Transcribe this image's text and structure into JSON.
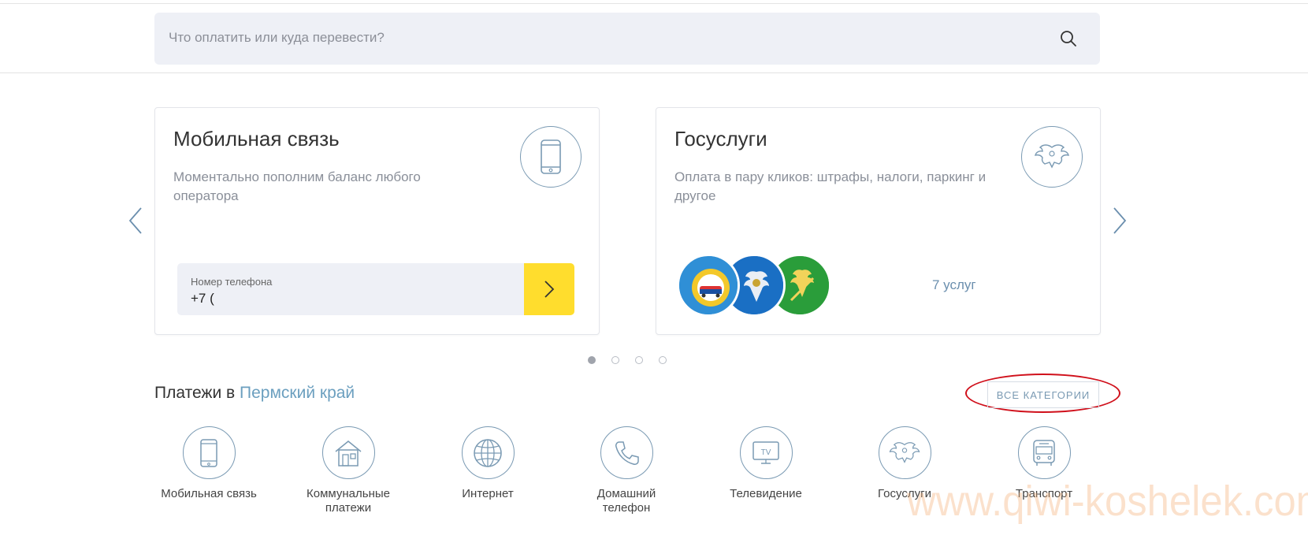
{
  "search": {
    "placeholder": "Что оплатить или куда перевести?"
  },
  "carousel": {
    "slides": [
      {
        "title": "Мобильная связь",
        "description": "Моментально пополним баланс любого оператора",
        "phone_label": "Номер телефона",
        "phone_value": "+7 ("
      },
      {
        "title": "Госуслуги",
        "description": "Оплата в пару кликов: штрафы, налоги, паркинг и другое",
        "services_count": "7 услуг"
      }
    ],
    "page_count": 4,
    "active_page": 1
  },
  "payments": {
    "title_prefix": "Платежи в",
    "region": "Пермский край",
    "all_categories": "ВСЕ КАТЕГОРИИ"
  },
  "categories": [
    {
      "label": "Мобильная связь",
      "icon": "smartphone-icon"
    },
    {
      "label": "Коммунальные платежи",
      "icon": "house-icon"
    },
    {
      "label": "Интернет",
      "icon": "globe-icon"
    },
    {
      "label": "Домашний телефон",
      "icon": "phone-handset-icon"
    },
    {
      "label": "Телевидение",
      "icon": "tv-icon"
    },
    {
      "label": "Госуслуги",
      "icon": "eagle-emblem-icon"
    },
    {
      "label": "Транспорт",
      "icon": "bus-icon"
    }
  ],
  "watermark": "www.qiwi-koshelek.com",
  "colors": {
    "accent_yellow": "#ffdd2d",
    "link_blue": "#6b9fbf",
    "icon_outline": "#7a9ab3",
    "highlight_red": "#d0101b"
  }
}
